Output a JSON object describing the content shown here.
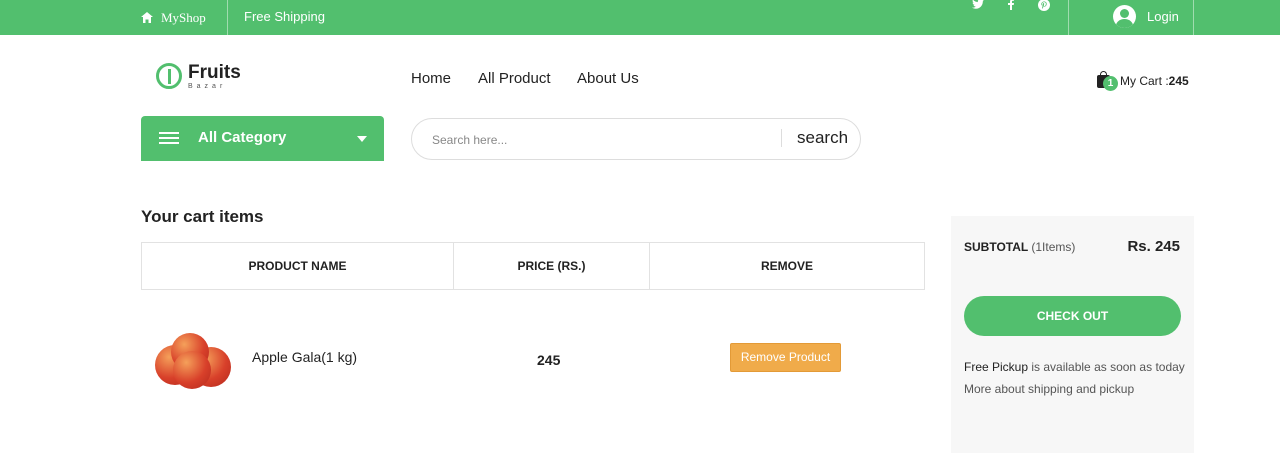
{
  "topbar": {
    "shop_name": "MyShop",
    "free_shipping": "Free Shipping",
    "login": "Login",
    "social": [
      "twitter-icon",
      "facebook-icon",
      "pinterest-icon"
    ],
    "color": "#52bf6e"
  },
  "logo": {
    "name": "Fruits",
    "sub": "Bazar"
  },
  "nav": {
    "items": [
      "Home",
      "All Product",
      "About Us"
    ]
  },
  "cart": {
    "count": "1",
    "label": "My Cart :",
    "amount": "245"
  },
  "category": {
    "label": "All Category"
  },
  "search": {
    "placeholder": "Search here...",
    "button": "search"
  },
  "cart_items": {
    "title": "Your cart items",
    "headers": [
      "PRODUCT NAME",
      "PRICE (RS.)",
      "REMOVE"
    ],
    "rows": [
      {
        "name": "Apple Gala(1 kg)",
        "price": "245",
        "remove": "Remove Product"
      }
    ]
  },
  "summary": {
    "subtotal_label": "SUBTOTAL",
    "items_label": "(1Items)",
    "total": "Rs. 245",
    "checkout": "CHECK OUT",
    "pickup_bold": "Free Pickup",
    "pickup_rest": " is available as soon as today",
    "more": "More about shipping and pickup"
  },
  "colors": {
    "accent": "#52bf6e",
    "remove_button": "#f0ab4a"
  }
}
